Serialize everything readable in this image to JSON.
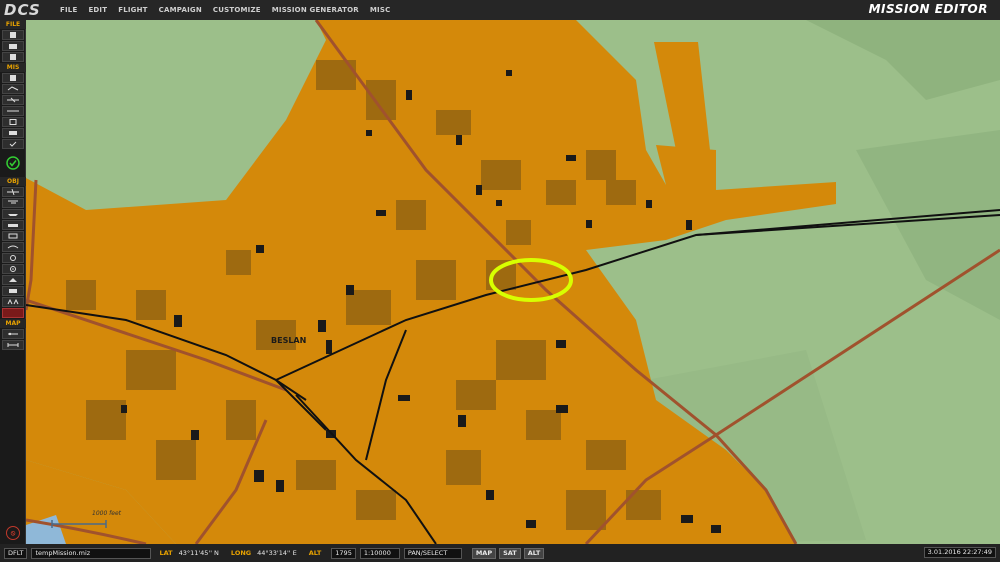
{
  "app": {
    "logo": "DCS",
    "title": "MISSION EDITOR"
  },
  "menu": [
    "FILE",
    "EDIT",
    "FLIGHT",
    "CAMPAIGN",
    "CUSTOMIZE",
    "MISSION GENERATOR",
    "MISC"
  ],
  "toolbar": {
    "sections": {
      "file": "FILE",
      "mis": "MIS",
      "obj": "OBJ",
      "map": "MAP"
    }
  },
  "map": {
    "town_label": "BESLAN",
    "scale_label": "1000 feet",
    "highlight_color": "#d8ff00",
    "town_color": "#d4890a",
    "terrain_color": "#9cbf8a",
    "road_color": "#a0522d"
  },
  "status": {
    "mode": "DFLT",
    "filename": "tempMission.miz",
    "lat_label": "LAT",
    "lat_value": "43°11'45'' N",
    "long_label": "LONG",
    "long_value": "44°33'14'' E",
    "alt_label": "ALT",
    "alt_value": "1795",
    "scale_value": "1:10000",
    "tool_mode": "PAN/SELECT",
    "map_btn": "MAP",
    "sat_btn": "SAT",
    "alt_btn": "ALT",
    "datetime": "3.01.2016 22:27:49"
  }
}
